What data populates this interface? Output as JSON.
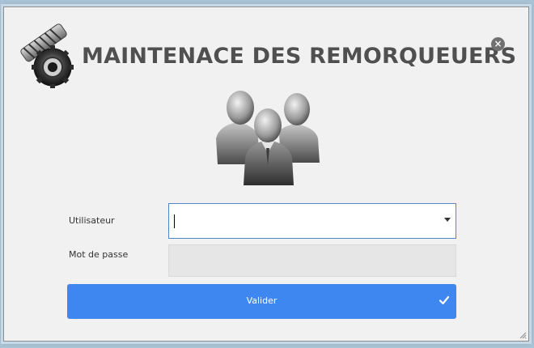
{
  "header": {
    "title": "MAINTENACE DES REMORQUEUERS",
    "logo_icon": "worm-gear-icon",
    "close_icon": "close-icon",
    "close_glyph": "×"
  },
  "hero": {
    "icon": "users-group-icon"
  },
  "form": {
    "user_label": "Utilisateur",
    "user_value": "",
    "user_dropdown_icon": "caret-down-icon",
    "password_label": "Mot de passe",
    "password_value": "",
    "submit_label": "Valider",
    "submit_icon": "checkmark-icon"
  },
  "colors": {
    "accent": "#3f87f0",
    "window_bg": "#f1f1f1",
    "title_text": "#505050",
    "input_border_focus": "#4e86c9",
    "disabled_input_bg": "#e6e6e6"
  }
}
